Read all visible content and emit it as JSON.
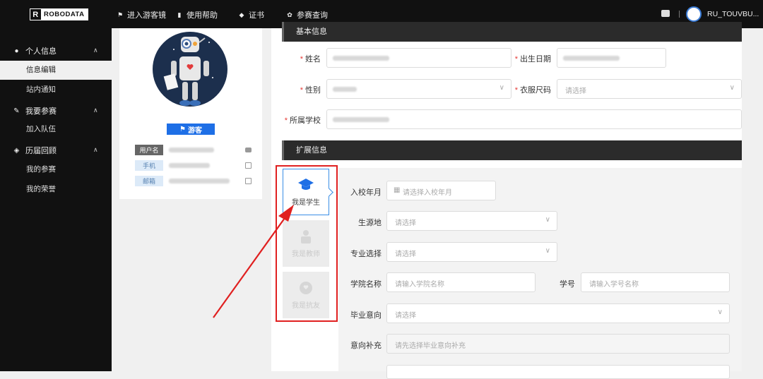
{
  "brand": {
    "letter": "R",
    "name": "ROBODATA"
  },
  "nav": [
    {
      "label": "进入游客镜",
      "icon": "flag-icon"
    },
    {
      "label": "使用帮助",
      "icon": "book-icon"
    },
    {
      "label": "证书",
      "icon": "diamond-icon"
    },
    {
      "label": "参赛查询",
      "icon": "gear-icon"
    }
  ],
  "user": {
    "name": "RU_TOUVBU..."
  },
  "sidebar": {
    "groups": [
      {
        "label": "个人信息",
        "icon": "user-icon",
        "items": [
          "信息编辑",
          "站内通知"
        ]
      },
      {
        "label": "我要参赛",
        "icon": "pen-icon",
        "items": [
          "加入队伍"
        ]
      },
      {
        "label": "历届回顾",
        "icon": "cube-icon",
        "items": [
          "我的参赛",
          "我的荣誉"
        ]
      }
    ],
    "active": "信息编辑"
  },
  "profile": {
    "badge": "游客",
    "fields": [
      {
        "tag": "用户名",
        "icon": "lock-icon"
      },
      {
        "tag": "手机",
        "icon": "edit-icon"
      },
      {
        "tag": "邮箱",
        "icon": "edit-icon"
      }
    ]
  },
  "basic": {
    "title": "基本信息",
    "name_label": "姓名",
    "birth_label": "出生日期",
    "gender_label": "性别",
    "size_label": "衣服尺码",
    "size_placeholder": "请选择",
    "school_label": "所属学校"
  },
  "ext": {
    "title": "扩展信息",
    "roles": [
      "我是学生",
      "我是教师",
      "我是抗友"
    ],
    "enroll_label": "入校年月",
    "enroll_placeholder": "请选择入校年月",
    "origin_label": "生源地",
    "origin_placeholder": "请选择",
    "major_label": "专业选择",
    "major_placeholder": "请选择",
    "college_label": "学院名称",
    "college_placeholder": "请输入学院名称",
    "sid_label": "学号",
    "sid_placeholder": "请输入学号名称",
    "grad_label": "毕业意向",
    "grad_placeholder": "请选择",
    "intent_label": "意向补充",
    "intent_placeholder": "请先选择毕业意向补充"
  },
  "colors": {
    "accent": "#1e6fe6",
    "highlight": "#e02020",
    "dark": "#111111"
  }
}
